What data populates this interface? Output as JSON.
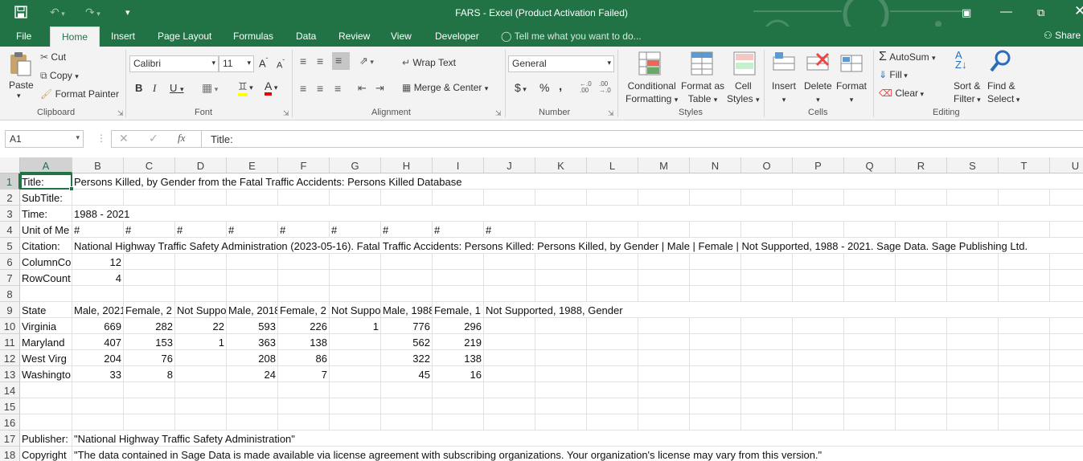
{
  "window": {
    "title": "FARS - Excel (Product Activation Failed)"
  },
  "tabs": [
    "File",
    "Home",
    "Insert",
    "Page Layout",
    "Formulas",
    "Data",
    "Review",
    "View",
    "Developer"
  ],
  "tell_me": "Tell me what you want to do...",
  "share": "Share",
  "ribbon": {
    "clipboard": {
      "paste": "Paste",
      "cut": "Cut",
      "copy": "Copy",
      "format_painter": "Format Painter",
      "label": "Clipboard"
    },
    "font": {
      "name": "Calibri",
      "size": "11",
      "bold": "B",
      "italic": "I",
      "underline": "U",
      "label": "Font"
    },
    "alignment": {
      "wrap": "Wrap Text",
      "merge": "Merge & Center",
      "label": "Alignment"
    },
    "number": {
      "format": "General",
      "currency": "$",
      "percent": "%",
      "comma": ",",
      "label": "Number"
    },
    "styles": {
      "conditional": "Conditional",
      "conditional2": "Formatting",
      "format_as": "Format as",
      "format_as2": "Table",
      "cell": "Cell",
      "cell2": "Styles",
      "label": "Styles"
    },
    "cells": {
      "insert": "Insert",
      "delete": "Delete",
      "format": "Format",
      "label": "Cells"
    },
    "editing": {
      "autosum": "AutoSum",
      "fill": "Fill",
      "clear": "Clear",
      "sort": "Sort &",
      "sort2": "Filter",
      "find": "Find &",
      "find2": "Select",
      "label": "Editing"
    }
  },
  "formula_bar": {
    "name_box": "A1",
    "fx": "fx",
    "content": "Title:"
  },
  "columns": [
    "A",
    "B",
    "C",
    "D",
    "E",
    "F",
    "G",
    "H",
    "I",
    "J",
    "K",
    "L",
    "M",
    "N",
    "O",
    "P",
    "Q",
    "R",
    "S",
    "T",
    "U"
  ],
  "selected": {
    "col": "A",
    "row": 1
  },
  "cells": [
    {
      "r": 1,
      "c": "A",
      "v": "Title:"
    },
    {
      "r": 1,
      "c": "B",
      "v": "Persons Killed, by Gender from the Fatal Traffic  Accidents: Persons Killed Database",
      "ovf": true
    },
    {
      "r": 2,
      "c": "A",
      "v": "SubTitle:"
    },
    {
      "r": 3,
      "c": "A",
      "v": "Time:"
    },
    {
      "r": 3,
      "c": "B",
      "v": "1988 - 2021",
      "ovf": true
    },
    {
      "r": 4,
      "c": "A",
      "v": "Unit of Me"
    },
    {
      "r": 4,
      "c": "B",
      "v": "#"
    },
    {
      "r": 4,
      "c": "C",
      "v": "#"
    },
    {
      "r": 4,
      "c": "D",
      "v": "#"
    },
    {
      "r": 4,
      "c": "E",
      "v": "#"
    },
    {
      "r": 4,
      "c": "F",
      "v": "#"
    },
    {
      "r": 4,
      "c": "G",
      "v": "#"
    },
    {
      "r": 4,
      "c": "H",
      "v": "#"
    },
    {
      "r": 4,
      "c": "I",
      "v": "#"
    },
    {
      "r": 4,
      "c": "J",
      "v": "#"
    },
    {
      "r": 5,
      "c": "A",
      "v": "Citation:"
    },
    {
      "r": 5,
      "c": "B",
      "v": "National Highway Traffic Safety Administration (2023-05-16). Fatal Traffic  Accidents: Persons Killed: Persons Killed, by Gender | Male | Female | Not Supported, 1988 - 2021. Sage Data. Sage Publishing Ltd.",
      "ovf": true
    },
    {
      "r": 6,
      "c": "A",
      "v": "ColumnCo"
    },
    {
      "r": 6,
      "c": "B",
      "v": "12",
      "num": true
    },
    {
      "r": 7,
      "c": "A",
      "v": "RowCount"
    },
    {
      "r": 7,
      "c": "B",
      "v": "4",
      "num": true
    },
    {
      "r": 9,
      "c": "A",
      "v": "State"
    },
    {
      "r": 9,
      "c": "B",
      "v": "Male, 2021"
    },
    {
      "r": 9,
      "c": "C",
      "v": "Female, 2"
    },
    {
      "r": 9,
      "c": "D",
      "v": "Not Suppo"
    },
    {
      "r": 9,
      "c": "E",
      "v": "Male, 2018"
    },
    {
      "r": 9,
      "c": "F",
      "v": "Female, 2"
    },
    {
      "r": 9,
      "c": "G",
      "v": "Not Suppo"
    },
    {
      "r": 9,
      "c": "H",
      "v": "Male, 1988"
    },
    {
      "r": 9,
      "c": "I",
      "v": "Female, 1"
    },
    {
      "r": 9,
      "c": "J",
      "v": "Not Supported, 1988, Gender",
      "ovf": true
    },
    {
      "r": 10,
      "c": "A",
      "v": "Virginia"
    },
    {
      "r": 10,
      "c": "B",
      "v": "669",
      "num": true
    },
    {
      "r": 10,
      "c": "C",
      "v": "282",
      "num": true
    },
    {
      "r": 10,
      "c": "D",
      "v": "22",
      "num": true
    },
    {
      "r": 10,
      "c": "E",
      "v": "593",
      "num": true
    },
    {
      "r": 10,
      "c": "F",
      "v": "226",
      "num": true
    },
    {
      "r": 10,
      "c": "G",
      "v": "1",
      "num": true
    },
    {
      "r": 10,
      "c": "H",
      "v": "776",
      "num": true
    },
    {
      "r": 10,
      "c": "I",
      "v": "296",
      "num": true
    },
    {
      "r": 11,
      "c": "A",
      "v": "Maryland"
    },
    {
      "r": 11,
      "c": "B",
      "v": "407",
      "num": true
    },
    {
      "r": 11,
      "c": "C",
      "v": "153",
      "num": true
    },
    {
      "r": 11,
      "c": "D",
      "v": "1",
      "num": true
    },
    {
      "r": 11,
      "c": "E",
      "v": "363",
      "num": true
    },
    {
      "r": 11,
      "c": "F",
      "v": "138",
      "num": true
    },
    {
      "r": 11,
      "c": "H",
      "v": "562",
      "num": true
    },
    {
      "r": 11,
      "c": "I",
      "v": "219",
      "num": true
    },
    {
      "r": 12,
      "c": "A",
      "v": "West Virg"
    },
    {
      "r": 12,
      "c": "B",
      "v": "204",
      "num": true
    },
    {
      "r": 12,
      "c": "C",
      "v": "76",
      "num": true
    },
    {
      "r": 12,
      "c": "E",
      "v": "208",
      "num": true
    },
    {
      "r": 12,
      "c": "F",
      "v": "86",
      "num": true
    },
    {
      "r": 12,
      "c": "H",
      "v": "322",
      "num": true
    },
    {
      "r": 12,
      "c": "I",
      "v": "138",
      "num": true
    },
    {
      "r": 13,
      "c": "A",
      "v": "Washingto"
    },
    {
      "r": 13,
      "c": "B",
      "v": "33",
      "num": true
    },
    {
      "r": 13,
      "c": "C",
      "v": "8",
      "num": true
    },
    {
      "r": 13,
      "c": "E",
      "v": "24",
      "num": true
    },
    {
      "r": 13,
      "c": "F",
      "v": "7",
      "num": true
    },
    {
      "r": 13,
      "c": "H",
      "v": "45",
      "num": true
    },
    {
      "r": 13,
      "c": "I",
      "v": "16",
      "num": true
    },
    {
      "r": 17,
      "c": "A",
      "v": "Publisher:"
    },
    {
      "r": 17,
      "c": "B",
      "v": " \"National Highway Traffic Safety Administration\"",
      "ovf": true
    },
    {
      "r": 18,
      "c": "A",
      "v": "Copyright"
    },
    {
      "r": 18,
      "c": "B",
      "v": " \"The data contained in Sage Data is made available via license agreement with subscribing organizations. Your organization's license may vary from this version.\"",
      "ovf": true
    }
  ],
  "rows": [
    1,
    2,
    3,
    4,
    5,
    6,
    7,
    8,
    9,
    10,
    11,
    12,
    13,
    14,
    15,
    16,
    17,
    18
  ]
}
